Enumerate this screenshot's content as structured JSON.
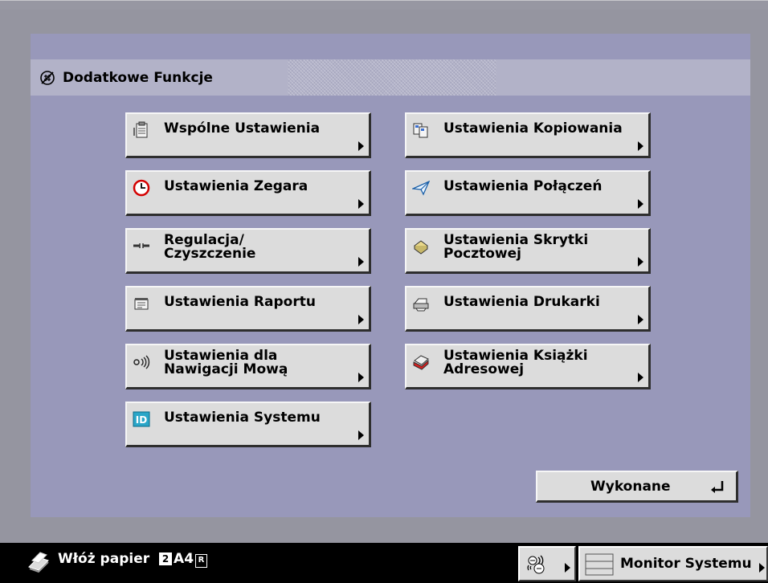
{
  "header": {
    "title": "Dodatkowe Funkcje",
    "icon": "additional-functions-icon"
  },
  "buttons": [
    {
      "id": "common-settings",
      "label": "Wspólne Ustawienia",
      "icon": "clipboard-icon"
    },
    {
      "id": "copy-settings",
      "label": "Ustawienia Kopiowania",
      "icon": "copy-documents-icon"
    },
    {
      "id": "timer-settings",
      "label": "Ustawienia Zegara",
      "icon": "clock-icon"
    },
    {
      "id": "communication-settings",
      "label": "Ustawienia Połączeń",
      "icon": "paper-plane-icon"
    },
    {
      "id": "adjustment-cleaning",
      "label": "Regulacja/\nCzyszczenie",
      "icon": "wrench-icon"
    },
    {
      "id": "mailbox-settings",
      "label": "Ustawienia Skrytki\nPocztowej",
      "icon": "mailbox-icon"
    },
    {
      "id": "report-settings",
      "label": "Ustawienia Raportu",
      "icon": "report-icon"
    },
    {
      "id": "printer-settings",
      "label": "Ustawienia Drukarki",
      "icon": "printer-icon"
    },
    {
      "id": "voice-guidance-settings",
      "label": "Ustawienia dla\nNawigacji Mową",
      "icon": "voice-waves-icon"
    },
    {
      "id": "address-book-settings",
      "label": "Ustawienia Książki\nAdresowej",
      "icon": "address-book-icon"
    },
    {
      "id": "system-settings",
      "label": "Ustawienia Systemu",
      "icon": "id-badge-icon"
    }
  ],
  "done_button": {
    "label": "Wykonane"
  },
  "status": {
    "message": "Włóż papier",
    "tray": "2",
    "paper_size": "A4",
    "orientation": "R"
  },
  "monitor_button": {
    "label": "Monitor Systemu"
  },
  "colors": {
    "background": "#9595a0",
    "panel": "#9898ba",
    "header_bar": "#b2b2c8",
    "button": "#dcdcdc",
    "status_bar": "#000000"
  }
}
